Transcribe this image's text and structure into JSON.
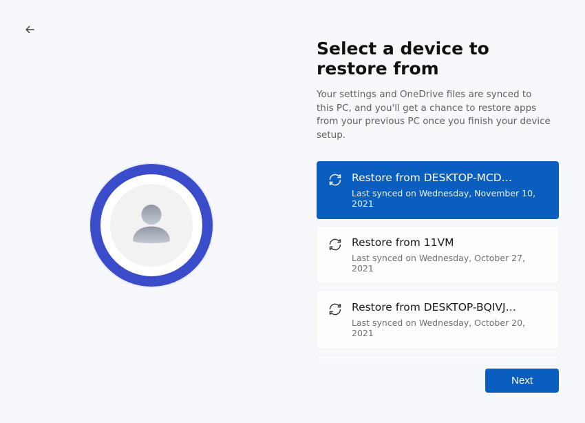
{
  "header": {
    "title": "Select a device to restore from",
    "description": "Your settings and OneDrive files are synced to this PC, and you'll get a chance to restore apps from your previous PC once you finish your device setup."
  },
  "devices": [
    {
      "title": "Restore from DESKTOP-MCD…",
      "sub": "Last synced on Wednesday, November 10, 2021",
      "selected": true
    },
    {
      "title": "Restore from 11VM",
      "sub": "Last synced on Wednesday, October 27, 2021",
      "selected": false
    },
    {
      "title": "Restore from DESKTOP-BQIVJ…",
      "sub": "Last synced on Wednesday, October 20, 2021",
      "selected": false
    }
  ],
  "footer": {
    "next_label": "Next"
  },
  "icons": {
    "back": "back-arrow-icon",
    "avatar": "person-icon",
    "sync": "sync-icon"
  }
}
